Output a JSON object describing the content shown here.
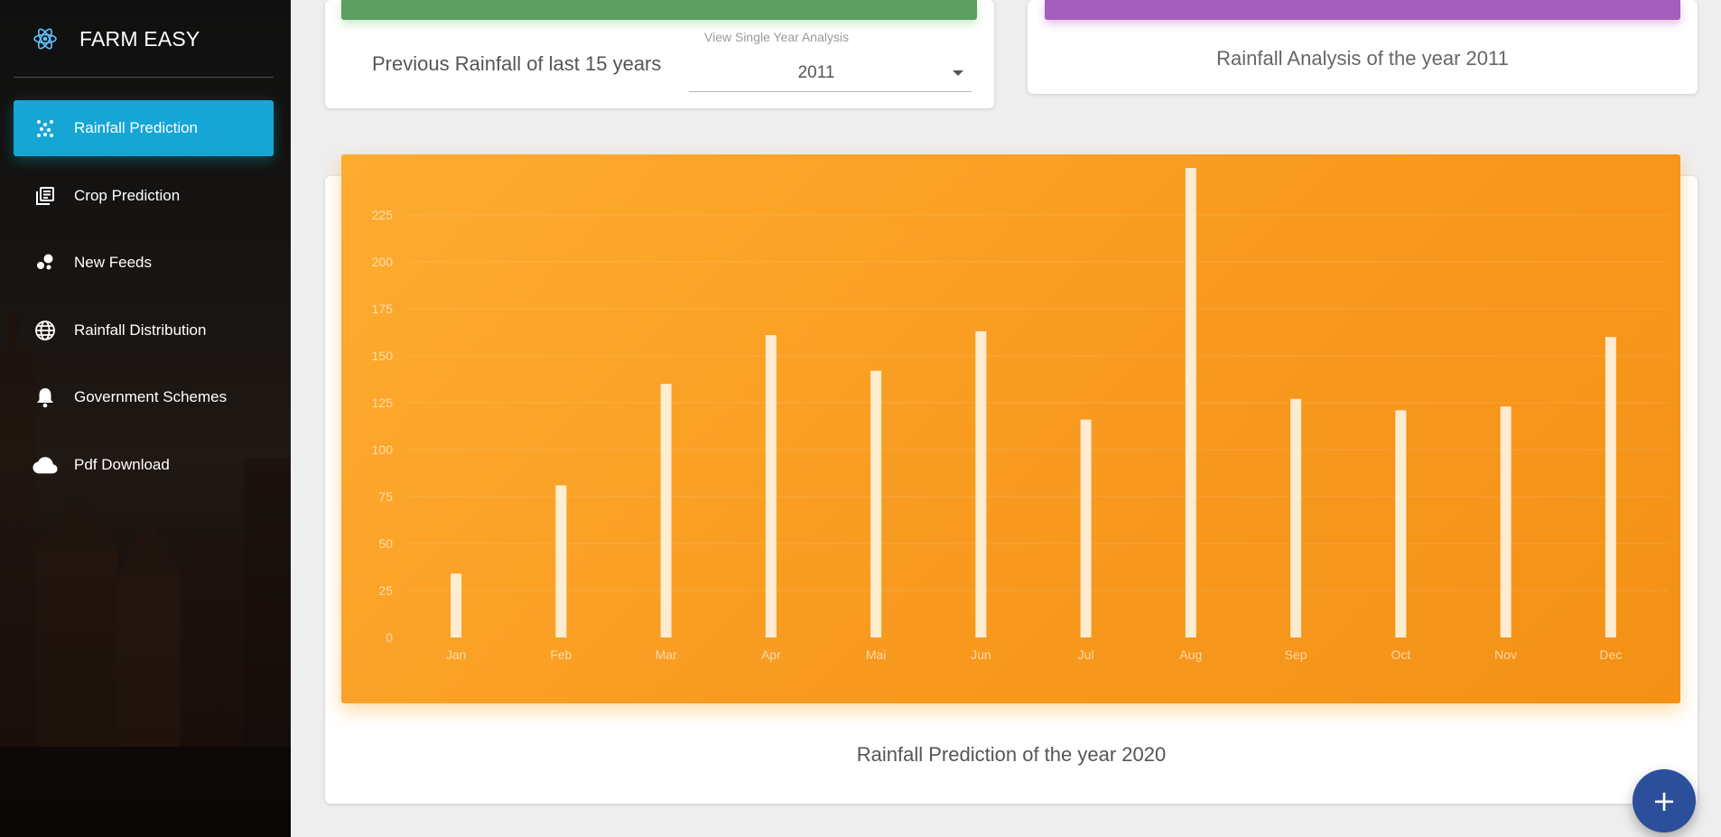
{
  "app": {
    "title": "FARM EASY",
    "accent": "#16a6d6"
  },
  "sidebar": {
    "items": [
      {
        "label": "Rainfall Prediction",
        "icon": "scatter-dots-icon",
        "active": true
      },
      {
        "label": "Crop Prediction",
        "icon": "library-books-icon",
        "active": false
      },
      {
        "label": "New Feeds",
        "icon": "bubble-chart-icon",
        "active": false
      },
      {
        "label": "Rainfall Distribution",
        "icon": "globe-icon",
        "active": false
      },
      {
        "label": "Government Schemes",
        "icon": "bell-icon",
        "active": false
      },
      {
        "label": "Pdf Download",
        "icon": "cloud-icon",
        "active": false
      }
    ]
  },
  "top_left_card": {
    "label": "Previous Rainfall of last 15 years",
    "select_caption": "View Single Year Analysis",
    "select_value": "2011",
    "header_color": "#5c9e5f"
  },
  "top_right_card": {
    "caption": "Rainfall Analysis of the year 2011",
    "header_color": "#a55ebb"
  },
  "chart_card": {
    "caption": "Rainfall Prediction of the year 2020"
  },
  "chart_data": {
    "type": "bar",
    "categories": [
      "Jan",
      "Feb",
      "Mar",
      "Apr",
      "Mai",
      "Jun",
      "Jul",
      "Aug",
      "Sep",
      "Oct",
      "Nov",
      "Dec"
    ],
    "values": [
      34,
      81,
      135,
      161,
      142,
      163,
      116,
      250,
      127,
      121,
      123,
      160
    ],
    "ylim": [
      0,
      250
    ],
    "yticks": [
      0,
      25,
      50,
      75,
      100,
      125,
      150,
      175,
      200,
      225
    ],
    "title": "",
    "xlabel": "",
    "ylabel": "",
    "grid": true,
    "bar_color": "#fff3e0",
    "panel_color": "#f89a1f"
  },
  "fab": {
    "symbol": "+"
  }
}
